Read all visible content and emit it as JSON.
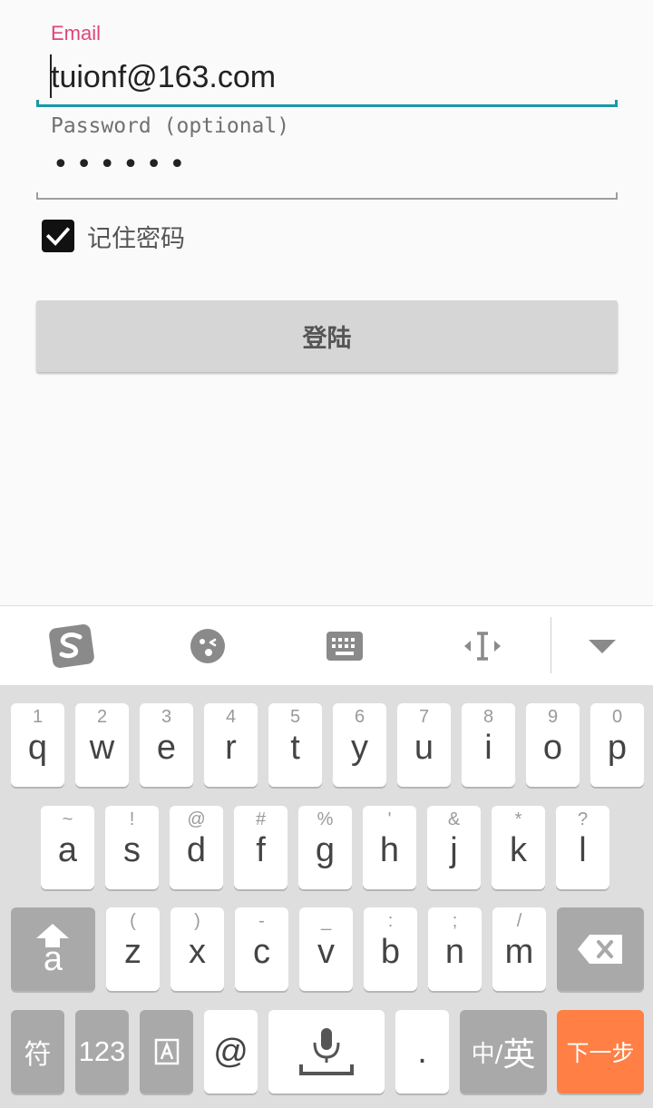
{
  "form": {
    "email_label": "Email",
    "email_value": "tuionf@163.com",
    "password_label": "Password (optional)",
    "password_mask": "••••••",
    "remember_label": "记住密码",
    "remember_checked": true,
    "login_button": "登陆"
  },
  "colors": {
    "email_label": "#e0457b",
    "email_underline": "#1a98a8",
    "login_button_bg": "#d6d6d6",
    "next_key_bg": "#ff7f45"
  },
  "keyboard": {
    "toolbar_icons": [
      "sogou-logo-icon",
      "emoji-icon",
      "keyboard-icon",
      "cursor-move-icon",
      "collapse-keyboard-icon"
    ],
    "row1": [
      {
        "hint": "1",
        "key": "q"
      },
      {
        "hint": "2",
        "key": "w"
      },
      {
        "hint": "3",
        "key": "e"
      },
      {
        "hint": "4",
        "key": "r"
      },
      {
        "hint": "5",
        "key": "t"
      },
      {
        "hint": "6",
        "key": "y"
      },
      {
        "hint": "7",
        "key": "u"
      },
      {
        "hint": "8",
        "key": "i"
      },
      {
        "hint": "9",
        "key": "o"
      },
      {
        "hint": "0",
        "key": "p"
      }
    ],
    "row2": [
      {
        "hint": "~",
        "key": "a"
      },
      {
        "hint": "!",
        "key": "s"
      },
      {
        "hint": "@",
        "key": "d"
      },
      {
        "hint": "#",
        "key": "f"
      },
      {
        "hint": "%",
        "key": "g"
      },
      {
        "hint": "'",
        "key": "h"
      },
      {
        "hint": "&",
        "key": "j"
      },
      {
        "hint": "*",
        "key": "k"
      },
      {
        "hint": "?",
        "key": "l"
      }
    ],
    "row3": [
      {
        "hint": "(",
        "key": "z"
      },
      {
        "hint": ")",
        "key": "x"
      },
      {
        "hint": "-",
        "key": "c"
      },
      {
        "hint": "_",
        "key": "v"
      },
      {
        "hint": ":",
        "key": "b"
      },
      {
        "hint": ";",
        "key": "n"
      },
      {
        "hint": "/",
        "key": "m"
      }
    ],
    "shift_letter": "a",
    "symbol_key": "符",
    "number_key": "123",
    "at_key": "@",
    "period_key": ".",
    "lang_key_zh": "中/",
    "lang_key_en": "英",
    "next_key": "下一步"
  }
}
